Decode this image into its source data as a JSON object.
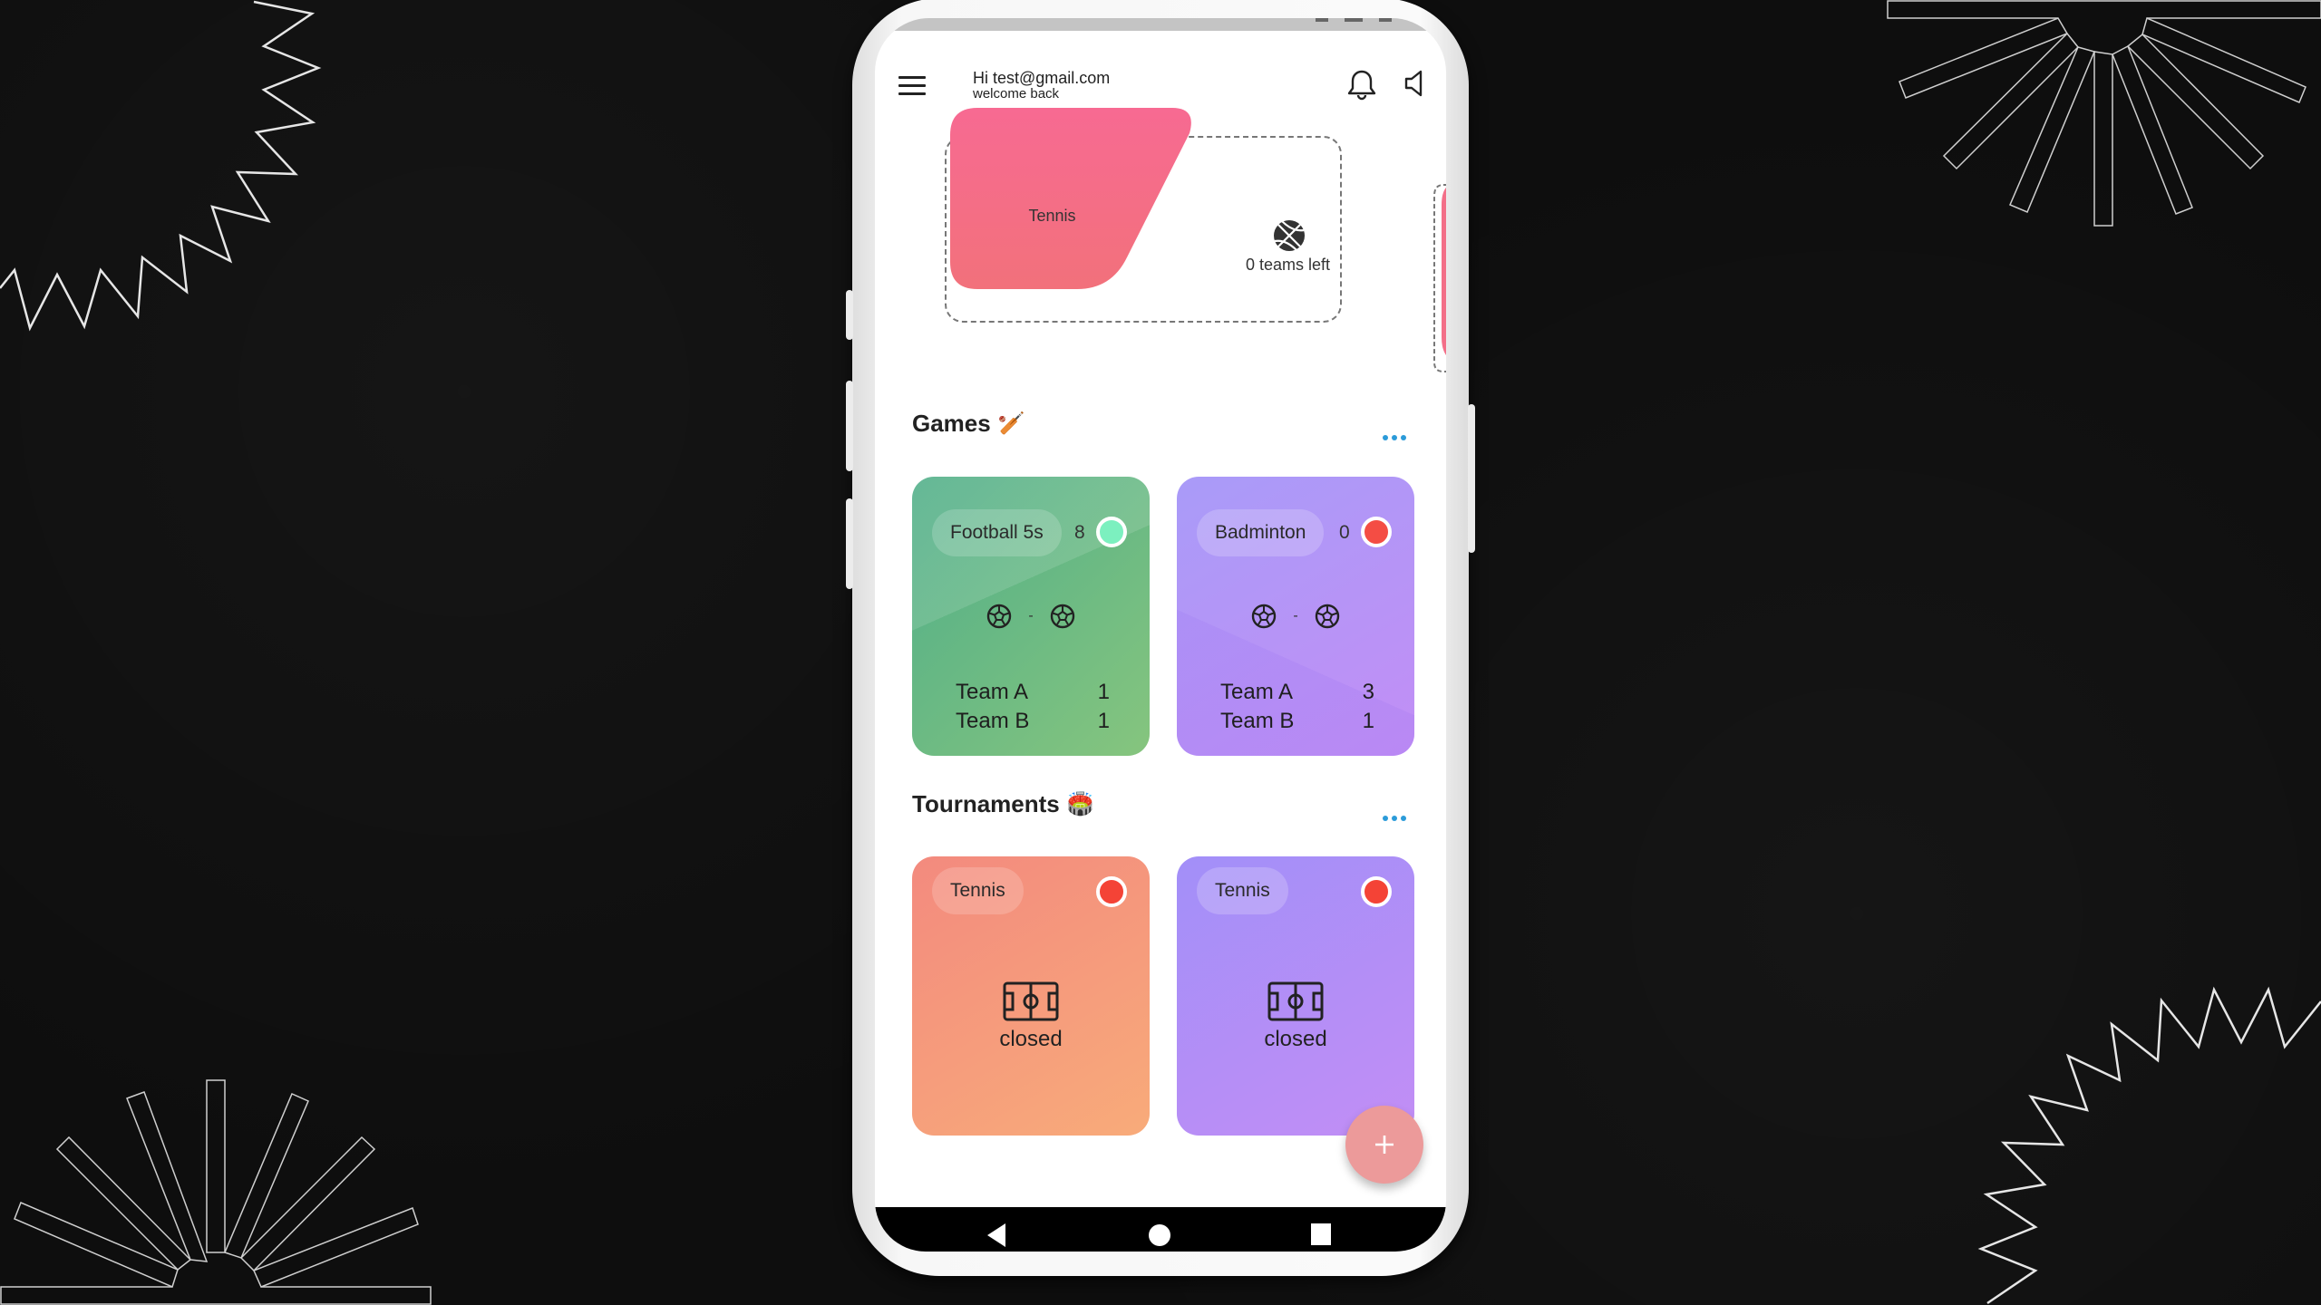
{
  "header": {
    "greeting": "Hi test@gmail.com",
    "subtitle": "welcome back",
    "icons": [
      "menu-icon",
      "bell-icon",
      "volume-icon"
    ]
  },
  "featured": {
    "items": [
      {
        "sport": "Tennis",
        "teams_left": "0 teams left",
        "icon": "basketball-icon",
        "color": "#f76b8a"
      }
    ]
  },
  "games": {
    "title": "Games",
    "emoji": "🏏",
    "more_label": "more",
    "cards": [
      {
        "sport": "Football 5s",
        "count": "8",
        "status_color": "#7cf0bf",
        "teams": [
          {
            "name": "Team A",
            "score": "1"
          },
          {
            "name": "Team B",
            "score": "1"
          }
        ],
        "vs": "-",
        "gradient": [
          "#4fae89",
          "#86c57e"
        ]
      },
      {
        "sport": "Badminton",
        "count": "0",
        "status_color": "#f44d44",
        "teams": [
          {
            "name": "Team A",
            "score": "3"
          },
          {
            "name": "Team B",
            "score": "1"
          }
        ],
        "vs": "-",
        "gradient": [
          "#a99bf8",
          "#c28ef5"
        ]
      }
    ]
  },
  "tournaments": {
    "title": "Tournaments",
    "emoji": "🏟️",
    "more_label": "more",
    "cards": [
      {
        "sport": "Tennis",
        "status": "closed",
        "status_color": "#f44336",
        "gradient": [
          "#f38a7e",
          "#f8ab7a"
        ]
      },
      {
        "sport": "Tennis",
        "status": "closed",
        "status_color": "#f44336",
        "gradient": [
          "#a28ff8",
          "#c28ef5"
        ]
      }
    ]
  },
  "fab": {
    "label": "+"
  },
  "navbar": {
    "buttons": [
      "back",
      "home",
      "recents"
    ]
  }
}
